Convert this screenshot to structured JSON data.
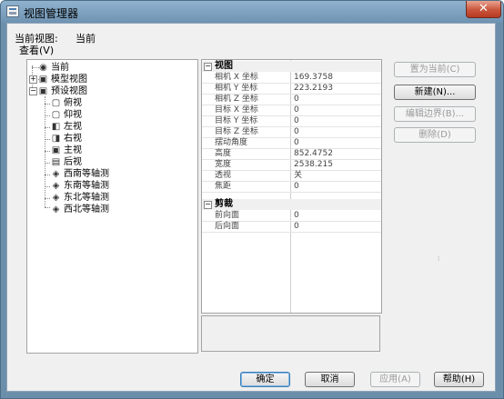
{
  "window": {
    "title": "视图管理器",
    "close_glyph": "✕"
  },
  "current_view": {
    "label": "当前视图:",
    "value": "当前"
  },
  "view_label": "查看(V)",
  "tree": {
    "current": "当前",
    "model_views": "模型视图",
    "preset_views": "预设视图",
    "presets": [
      "俯视",
      "仰视",
      "左视",
      "右视",
      "主视",
      "后视",
      "西南等轴测",
      "东南等轴测",
      "东北等轴测",
      "西北等轴测"
    ]
  },
  "properties": {
    "cat_view": "视图",
    "view_rows": [
      {
        "name": "相机 X 坐标",
        "value": "169.3758"
      },
      {
        "name": "相机 Y 坐标",
        "value": "223.2193"
      },
      {
        "name": "相机 Z 坐标",
        "value": "0"
      },
      {
        "name": "目标 X 坐标",
        "value": "0"
      },
      {
        "name": "目标 Y 坐标",
        "value": "0"
      },
      {
        "name": "目标 Z 坐标",
        "value": "0"
      },
      {
        "name": "摆动角度",
        "value": "0"
      },
      {
        "name": "高度",
        "value": "852.4752"
      },
      {
        "name": "宽度",
        "value": "2538.215"
      },
      {
        "name": "透视",
        "value": "关"
      },
      {
        "name": "焦距",
        "value": "0"
      }
    ],
    "cat_clip": "剪裁",
    "clip_rows": [
      {
        "name": "前向面",
        "value": "0"
      },
      {
        "name": "后向面",
        "value": "0"
      }
    ]
  },
  "buttons": {
    "set_current": "置为当前(C)",
    "new": "新建(N)...",
    "edit_boundaries": "编辑边界(B)...",
    "delete": "删除(D)",
    "ok": "确定",
    "cancel": "取消",
    "apply": "应用(A)",
    "help": "帮助(H)"
  }
}
